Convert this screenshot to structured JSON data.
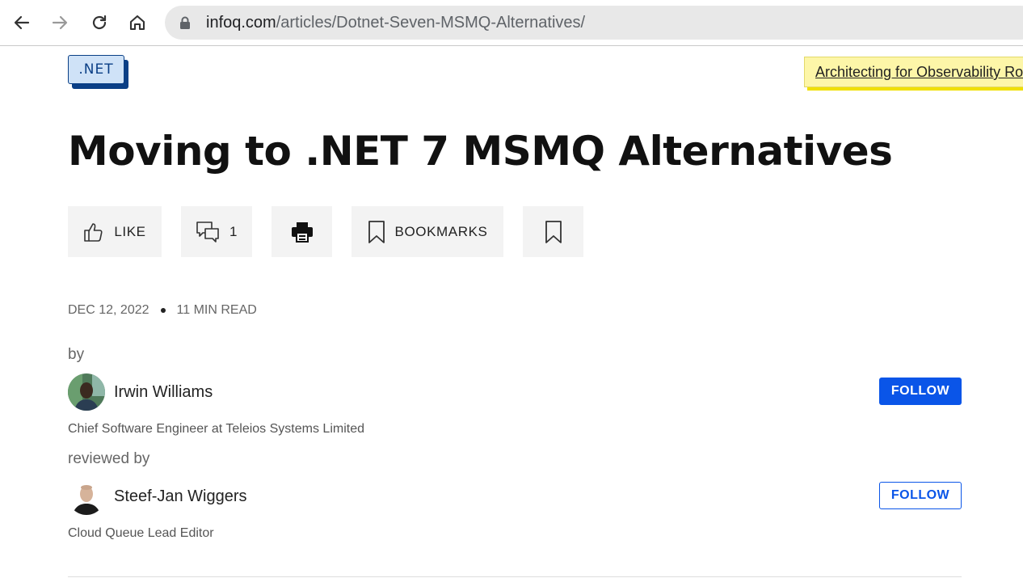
{
  "browser": {
    "url_host": "infoq.com",
    "url_path": "/articles/Dotnet-Seven-MSMQ-Alternatives/",
    "icons": {
      "back": "back-arrow-icon",
      "forward": "forward-arrow-icon",
      "reload": "reload-icon",
      "home": "home-icon",
      "lock": "lock-icon"
    }
  },
  "article": {
    "topic_tag": ".NET",
    "promo_link": "Architecting for Observability Ro",
    "title": "Moving to .NET 7 MSMQ Alternatives",
    "actions": {
      "like_label": "LIKE",
      "comments_count": "1",
      "bookmarks_label": "BOOKMARKS"
    },
    "date": "DEC 12, 2022",
    "read_time": "11 MIN READ",
    "by_label": "by",
    "author": {
      "name": "Irwin Williams",
      "role": "Chief Software Engineer at Teleios Systems Limited",
      "follow_label": "FOLLOW"
    },
    "reviewed_by_label": "reviewed by",
    "reviewer": {
      "name": "Steef-Jan Wiggers",
      "role": "Cloud Queue Lead Editor",
      "follow_label": "FOLLOW"
    }
  },
  "colors": {
    "accent_blue": "#0a55e8",
    "tag_navy": "#0a3f86",
    "tag_bg": "#cfe2f7",
    "promo_yellow": "#fdf6a8"
  }
}
